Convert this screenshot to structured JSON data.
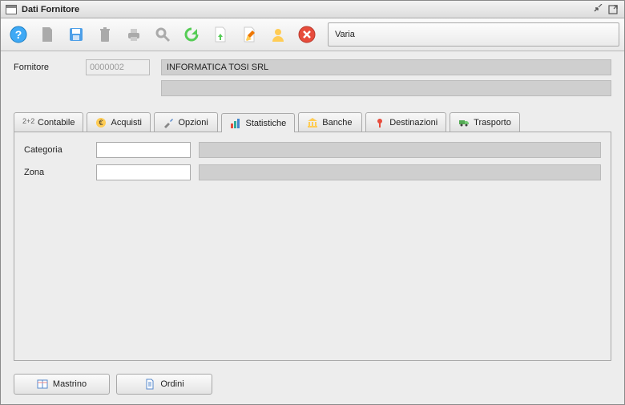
{
  "window": {
    "title": "Dati Fornitore"
  },
  "toolbar": {
    "varia_label": "Varia"
  },
  "header": {
    "fornitore_label": "Fornitore",
    "fornitore_code": "0000002",
    "fornitore_name": "INFORMATICA TOSI SRL",
    "fornitore_line2": ""
  },
  "tabs": {
    "contabile": "Contabile",
    "acquisti": "Acquisti",
    "opzioni": "Opzioni",
    "statistiche": "Statistiche",
    "banche": "Banche",
    "destinazioni": "Destinazioni",
    "trasporto": "Trasporto",
    "active": "statistiche"
  },
  "panel": {
    "categoria_label": "Categoria",
    "categoria_value": "",
    "categoria_desc": "",
    "zona_label": "Zona",
    "zona_value": "",
    "zona_desc": ""
  },
  "footer": {
    "mastrino": "Mastrino",
    "ordini": "Ordini"
  }
}
